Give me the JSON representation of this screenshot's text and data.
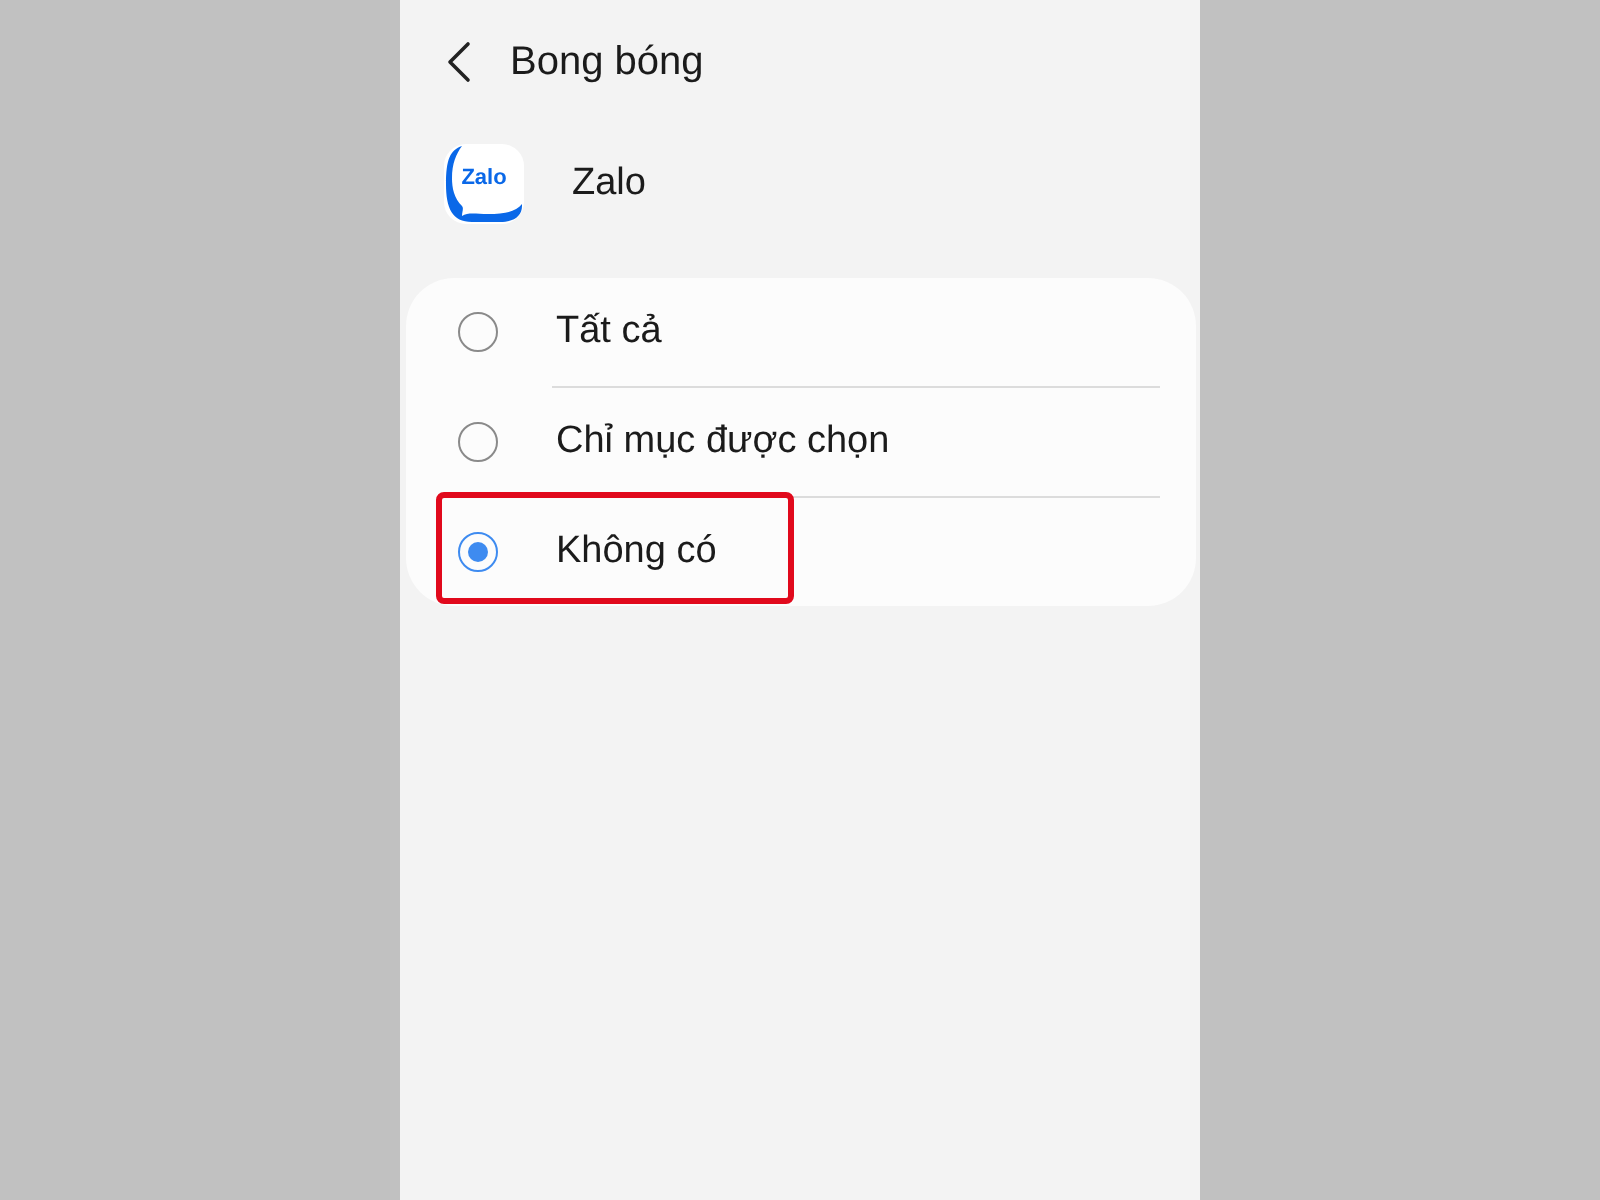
{
  "header": {
    "title": "Bong bóng"
  },
  "app": {
    "name": "Zalo",
    "logo_text": "Zalo"
  },
  "options": [
    {
      "label": "Tất cả",
      "selected": false,
      "highlighted": false
    },
    {
      "label": "Chỉ mục được chọn",
      "selected": false,
      "highlighted": false
    },
    {
      "label": "Không có",
      "selected": true,
      "highlighted": true
    }
  ]
}
